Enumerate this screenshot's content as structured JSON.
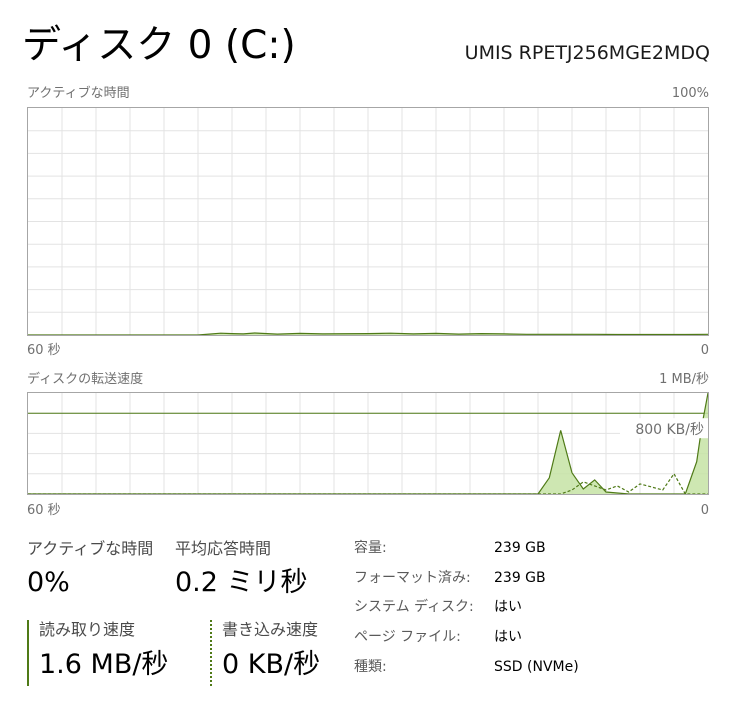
{
  "header": {
    "title": "ディスク 0 (C:)",
    "model": "UMIS RPETJ256MGE2MDQ"
  },
  "active_chart": {
    "label": "アクティブな時間",
    "max_label": "100%",
    "time_left": "60 秒",
    "time_right": "0"
  },
  "transfer_chart": {
    "label": "ディスクの転送速度",
    "max_label": "1 MB/秒",
    "marker_label": "800 KB/秒",
    "time_left": "60 秒",
    "time_right": "0"
  },
  "chart_data": [
    {
      "type": "area",
      "title": "アクティブな時間",
      "xlabel_left": "60 秒",
      "xlabel_right": "0",
      "ylim": [
        0,
        100
      ],
      "y_unit": "%",
      "grid": true,
      "series": [
        {
          "name": "アクティブな時間",
          "color": "#4f7a17",
          "fill": "#c5e3a4",
          "x": [
            60,
            45,
            44,
            43,
            42,
            41,
            40,
            38,
            36,
            34,
            30,
            28,
            26,
            24,
            22,
            20,
            18,
            16,
            14,
            12,
            10,
            8,
            6,
            4,
            2,
            0
          ],
          "y": [
            0,
            0,
            0.4,
            0.8,
            0.6,
            0.5,
            0.9,
            0.4,
            0.7,
            0.5,
            0.6,
            0.8,
            0.5,
            0.7,
            0.4,
            0.6,
            0.5,
            0.3,
            0.3,
            0.3,
            0.3,
            0.2,
            0.2,
            0.2,
            0.2,
            0.3
          ]
        }
      ]
    },
    {
      "type": "area",
      "title": "ディスクの転送速度",
      "xlabel_left": "60 秒",
      "xlabel_right": "0",
      "ylim": [
        0,
        1000
      ],
      "y_unit": "KB/秒",
      "grid": true,
      "reference_line": 800,
      "series": [
        {
          "name": "読み取り速度",
          "color": "#4f7a17",
          "fill": "#c5e3a4",
          "style": "solid",
          "x": [
            60,
            15,
            14,
            13,
            12,
            11,
            10,
            9,
            8,
            7,
            6,
            5,
            4,
            3,
            2,
            1,
            0.5,
            0
          ],
          "y": [
            0,
            0,
            160,
            630,
            210,
            50,
            140,
            20,
            10,
            0,
            0,
            0,
            0,
            0,
            0,
            320,
            700,
            1000
          ]
        },
        {
          "name": "書き込み速度",
          "color": "#4f7a17",
          "style": "dashed",
          "x": [
            60,
            14,
            13,
            12,
            11,
            10,
            9,
            8,
            7,
            6,
            5,
            4,
            3,
            2,
            1,
            0
          ],
          "y": [
            0,
            0,
            0,
            40,
            120,
            80,
            40,
            80,
            20,
            100,
            70,
            40,
            200,
            0,
            0,
            0
          ]
        }
      ]
    }
  ],
  "stats": {
    "active_label": "アクティブな時間",
    "active_value": "0%",
    "response_label": "平均応答時間",
    "response_value": "0.2 ミリ秒",
    "read_label": "読み取り速度",
    "read_value": "1.6 MB/秒",
    "write_label": "書き込み速度",
    "write_value": "0 KB/秒"
  },
  "info": [
    {
      "key": "容量:",
      "value": "239 GB"
    },
    {
      "key": "フォーマット済み:",
      "value": "239 GB"
    },
    {
      "key": "システム ディスク:",
      "value": "はい"
    },
    {
      "key": "ページ ファイル:",
      "value": "はい"
    },
    {
      "key": "種類:",
      "value": "SSD (NVMe)"
    }
  ],
  "colors": {
    "accent": "#4f7a17",
    "fill": "#c5e3a4",
    "grid": "#e3e3e3",
    "border": "#a6a6a6"
  }
}
